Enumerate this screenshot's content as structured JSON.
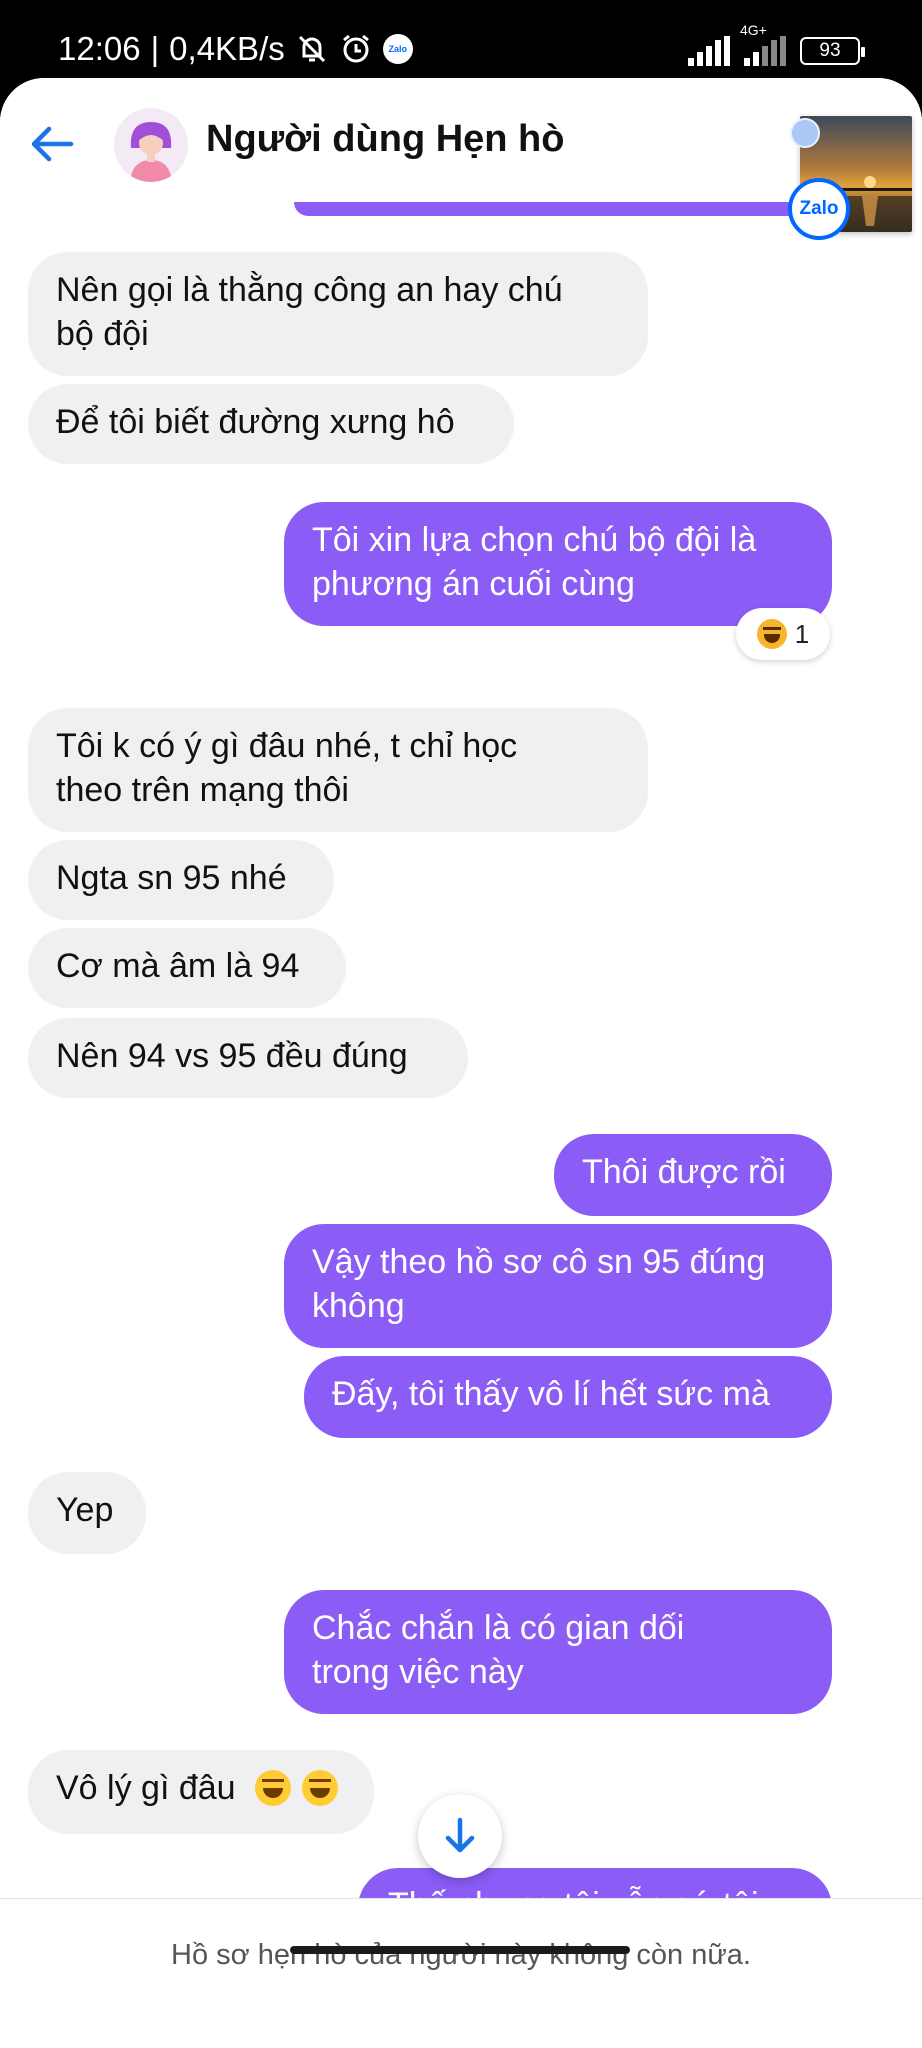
{
  "status_bar": {
    "time": "12:06",
    "separator": "|",
    "net_speed": "0,4KB/s",
    "network_type": "4G+",
    "battery": "93",
    "icons": [
      "mute-icon",
      "alarm-icon",
      "zalo-notification-icon",
      "signal-icon",
      "battery-icon"
    ]
  },
  "header": {
    "contact_name": "Người dùng Hẹn hò",
    "back_icon": "arrow-left-icon",
    "floating_badge": "Zalo"
  },
  "messages": [
    {
      "side": "in",
      "lines": [
        "Nên gọi là thằng công an hay chú",
        "bộ đội"
      ]
    },
    {
      "side": "in",
      "lines": [
        "Để tôi biết đường xưng hô"
      ]
    },
    {
      "side": "out",
      "lines": [
        "Tôi xin lựa chọn chú bộ đội là",
        "phương án cuối cùng"
      ],
      "reaction": {
        "emoji": "laughing-face",
        "count": "1"
      }
    },
    {
      "side": "in",
      "lines": [
        "Tôi k có ý gì đâu nhé, t chỉ học",
        "theo trên mạng thôi"
      ]
    },
    {
      "side": "in",
      "lines": [
        "Ngta sn 95 nhé"
      ]
    },
    {
      "side": "in",
      "lines": [
        "Cơ mà âm là 94"
      ]
    },
    {
      "side": "in",
      "lines": [
        "Nên 94 vs 95 đều đúng"
      ]
    },
    {
      "side": "out",
      "lines": [
        "Thôi được rồi"
      ]
    },
    {
      "side": "out",
      "lines": [
        "Vậy theo hồ sơ cô sn 95 đúng",
        "không"
      ]
    },
    {
      "side": "out",
      "lines": [
        "Đấy, tôi thấy vô lí hết sức mà"
      ]
    },
    {
      "side": "in",
      "lines": [
        "Yep"
      ]
    },
    {
      "side": "out",
      "lines": [
        "Chắc chắn là có gian dối",
        "trong việc này"
      ]
    },
    {
      "side": "in",
      "lines": [
        "Vô lý gì đâu"
      ],
      "emoji": [
        "grinning-face",
        "grinning-face"
      ]
    }
  ],
  "partial_message": "Thế nhưng tôi vẫn cứ tôi",
  "footer": {
    "notice": "Hồ sơ hẹn hò của người này không còn nữa."
  },
  "colors": {
    "outgoing_bubble": "#8b5cf6",
    "incoming_bubble": "#f0f0f3",
    "accent_blue": "#1a73e8",
    "zalo_blue": "#0068ff"
  }
}
